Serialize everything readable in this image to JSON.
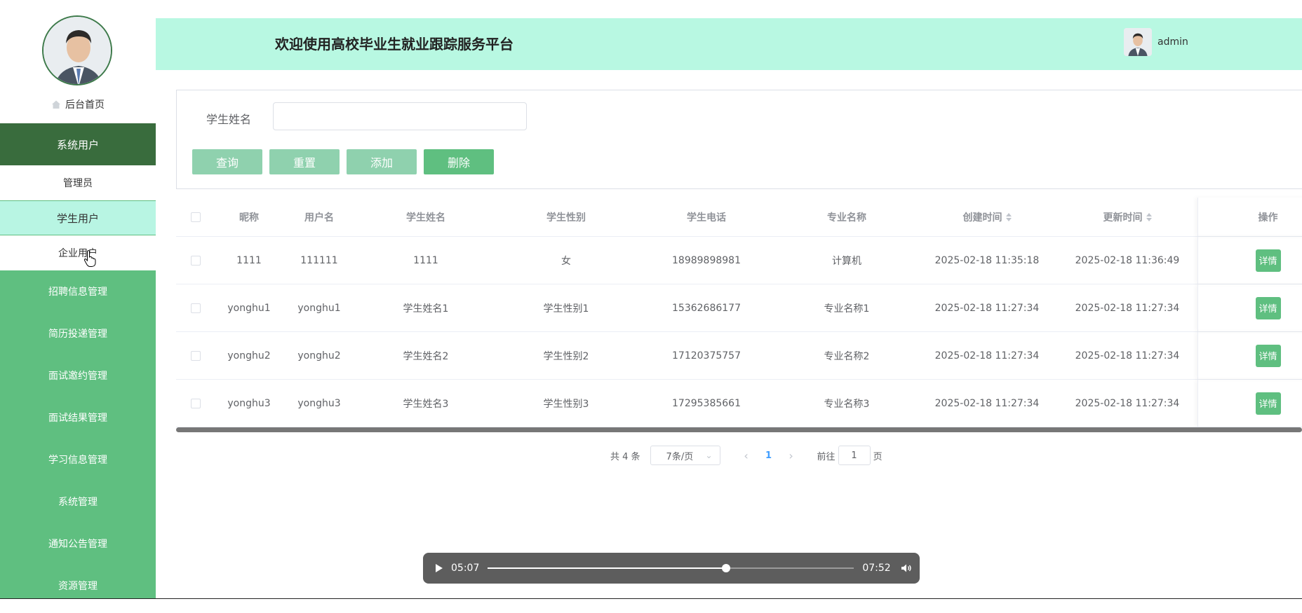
{
  "header": {
    "title": "欢迎使用高校毕业生就业跟踪服务平台",
    "username": "admin"
  },
  "sidebar": {
    "home": "后台首页",
    "system_users": "系统用户",
    "sub_items": {
      "admin": "管理员",
      "student": "学生用户",
      "company": "企业用户"
    },
    "menu": [
      "招聘信息管理",
      "简历投递管理",
      "面试邀约管理",
      "面试结果管理",
      "学习信息管理",
      "系统管理",
      "通知公告管理",
      "资源管理"
    ]
  },
  "search": {
    "label": "学生姓名",
    "value": "",
    "placeholder": ""
  },
  "buttons": {
    "query": "查询",
    "reset": "重置",
    "add": "添加",
    "delete": "删除"
  },
  "table": {
    "headers": {
      "nickname": "昵称",
      "username": "用户名",
      "name": "学生姓名",
      "gender": "学生性别",
      "phone": "学生电话",
      "major": "专业名称",
      "created": "创建时间",
      "updated": "更新时间",
      "ops": "操作"
    },
    "rows": [
      {
        "nickname": "1111",
        "username": "111111",
        "name": "1111",
        "gender": "女",
        "phone": "18989898981",
        "major": "计算机",
        "created": "2025-02-18 11:35:18",
        "updated": "2025-02-18 11:36:49",
        "action": "详情"
      },
      {
        "nickname": "yonghu1",
        "username": "yonghu1",
        "name": "学生姓名1",
        "gender": "学生性别1",
        "phone": "15362686177",
        "major": "专业名称1",
        "created": "2025-02-18 11:27:34",
        "updated": "2025-02-18 11:27:34",
        "action": "详情"
      },
      {
        "nickname": "yonghu2",
        "username": "yonghu2",
        "name": "学生姓名2",
        "gender": "学生性别2",
        "phone": "17120375757",
        "major": "专业名称2",
        "created": "2025-02-18 11:27:34",
        "updated": "2025-02-18 11:27:34",
        "action": "详情"
      },
      {
        "nickname": "yonghu3",
        "username": "yonghu3",
        "name": "学生姓名3",
        "gender": "学生性别3",
        "phone": "17295385661",
        "major": "专业名称3",
        "created": "2025-02-18 11:27:34",
        "updated": "2025-02-18 11:27:34",
        "action": "详情"
      }
    ]
  },
  "pagination": {
    "total": "共 4 条",
    "page_size": "7条/页",
    "current_page": "1",
    "goto_prefix": "前往",
    "goto_value": "1",
    "goto_suffix": "页"
  },
  "video": {
    "current_time": "05:07",
    "total_time": "07:52",
    "progress": 0.65
  },
  "colors": {
    "sidebar": "#5fbf80",
    "sidebar_active": "#396c3d",
    "header": "#b8f8e2",
    "accent": "#5fbf80"
  },
  "icons": {
    "home": "home-icon",
    "play": "play-icon",
    "volume": "volume-icon",
    "sort": "sort-icon"
  }
}
